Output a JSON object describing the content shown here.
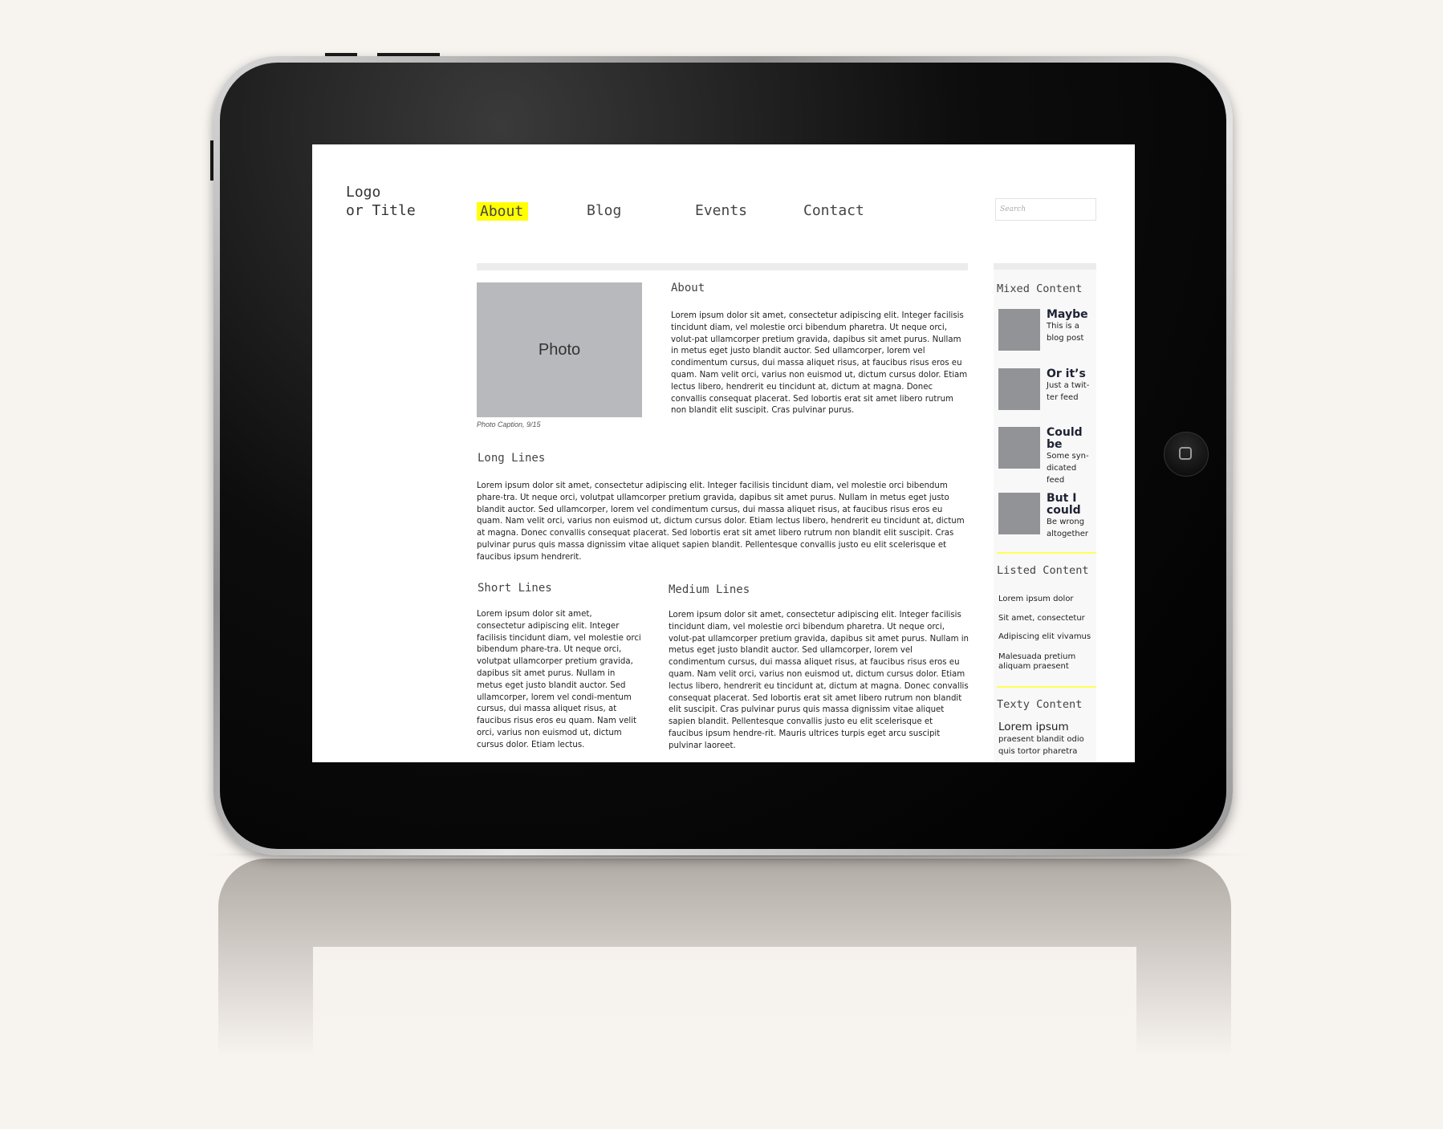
{
  "header": {
    "logo": "Logo\nor Title",
    "nav": [
      {
        "label": "About",
        "active": true
      },
      {
        "label": "Blog",
        "active": false
      },
      {
        "label": "Events",
        "active": false
      },
      {
        "label": "Contact",
        "active": false
      }
    ],
    "search_placeholder": "Search"
  },
  "main": {
    "photo_label": "Photo",
    "photo_caption": "Photo Caption, 9/15",
    "about": {
      "heading": "About",
      "text": "Lorem ipsum dolor sit amet, consectetur adipiscing elit. Integer facilisis tincidunt diam, vel molestie orci bibendum pharetra. Ut neque orci, volut-pat ullamcorper pretium gravida, dapibus sit amet purus. Nullam in metus eget justo blandit auctor. Sed ullamcorper, lorem vel condimentum cursus, dui massa aliquet risus, at faucibus risus eros eu quam. Nam velit orci, varius non euismod ut, dictum cursus dolor. Etiam lectus libero, hendrerit eu tincidunt at, dictum at magna. Donec convallis consequat placerat. Sed lobortis erat sit amet libero rutrum non blandit elit suscipit. Cras pulvinar purus."
    },
    "long_lines": {
      "heading": "Long Lines",
      "text": "Lorem ipsum dolor sit amet, consectetur adipiscing elit. Integer facilisis tincidunt diam, vel molestie orci bibendum phare-tra. Ut neque orci, volutpat ullamcorper pretium gravida, dapibus sit amet purus. Nullam in metus eget justo blandit auctor. Sed ullamcorper, lorem vel condimentum cursus, dui massa aliquet risus, at faucibus risus eros eu quam. Nam velit orci, varius non euismod ut, dictum cursus dolor. Etiam lectus libero, hendrerit eu tincidunt at, dictum at magna. Donec convallis consequat placerat. Sed lobortis erat sit amet libero rutrum non blandit elit suscipit. Cras pulvinar purus quis massa dignissim vitae aliquet sapien blandit. Pellentesque convallis justo eu elit scelerisque et faucibus ipsum hendrerit."
    },
    "short_lines": {
      "heading": "Short Lines",
      "text": "Lorem ipsum dolor sit amet, consectetur adipiscing elit. Integer facilisis tincidunt diam, vel molestie orci bibendum phare-tra. Ut neque orci, volutpat ullamcorper pretium gravida, dapibus sit amet purus. Nullam in metus eget justo blandit auctor. Sed ullamcorper, lorem vel condi-mentum cursus, dui massa aliquet risus, at faucibus risus eros eu quam. Nam velit orci, varius non euismod ut, dictum cursus dolor. Etiam lectus."
    },
    "medium_lines": {
      "heading": "Medium Lines",
      "text": "Lorem ipsum dolor sit amet, consectetur adipiscing elit. Integer facilisis tincidunt diam, vel molestie orci bibendum pharetra. Ut neque orci, volut-pat ullamcorper pretium gravida, dapibus sit amet purus. Nullam in metus eget justo blandit auctor. Sed ullamcorper, lorem vel condimentum cursus, dui massa aliquet risus, at faucibus risus eros eu quam. Nam velit orci, varius non euismod ut, dictum cursus dolor. Etiam lectus libero, hendrerit eu tincidunt at, dictum at magna. Donec convallis consequat placerat. Sed lobortis erat sit amet libero rutrum non blandit elit suscipit. Cras pulvinar purus quis massa dignissim vitae aliquet sapien blandit. Pellentesque convallis justo eu elit scelerisque et faucibus ipsum hendre-rit. Mauris ultrices turpis eget arcu suscipit pulvinar laoreet."
    }
  },
  "sidebar": {
    "mixed": {
      "heading": "Mixed Content",
      "items": [
        {
          "title": "Maybe",
          "subtitle": "This is a blog post"
        },
        {
          "title": "Or it’s",
          "subtitle": "Just a twit-ter feed"
        },
        {
          "title": "Could be",
          "subtitle": "Some syn-dicated feed"
        },
        {
          "title": "But I could",
          "subtitle": "Be wrong altogether"
        }
      ]
    },
    "listed": {
      "heading": "Listed Content",
      "items": [
        "Lorem ipsum dolor",
        "Sit amet, consectetur",
        "Adipiscing elit vivamus",
        "Malesuada pretium aliquam praesent"
      ]
    },
    "texty": {
      "heading": "Texty Content",
      "big": "Lorem ipsum",
      "small": "praesent blandit odio quis tortor pharetra"
    }
  },
  "colors": {
    "highlight": "#ffff00",
    "photo_placeholder": "#b8b9bc",
    "thumb_placeholder": "#929396",
    "page_background": "#f7f3ef"
  },
  "icons": [
    "home-button-icon"
  ]
}
